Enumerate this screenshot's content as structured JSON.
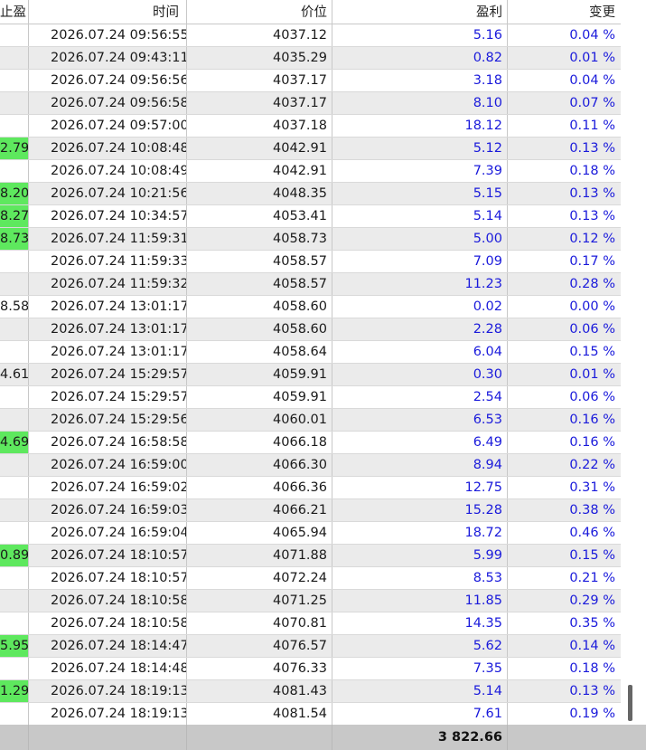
{
  "columns": [
    "止盈",
    "时间",
    "价位",
    "盈利",
    "变更"
  ],
  "rows": [
    {
      "tp": "",
      "time": "2026.07.24 09:56:55",
      "price": "4037.12",
      "profit": "5.16",
      "change": "0.04 %",
      "tp_highlight": false
    },
    {
      "tp": "",
      "time": "2026.07.24 09:43:11",
      "price": "4035.29",
      "profit": "0.82",
      "change": "0.01 %",
      "tp_highlight": false
    },
    {
      "tp": "",
      "time": "2026.07.24 09:56:56",
      "price": "4037.17",
      "profit": "3.18",
      "change": "0.04 %",
      "tp_highlight": false
    },
    {
      "tp": "",
      "time": "2026.07.24 09:56:58",
      "price": "4037.17",
      "profit": "8.10",
      "change": "0.07 %",
      "tp_highlight": false
    },
    {
      "tp": "",
      "time": "2026.07.24 09:57:00",
      "price": "4037.18",
      "profit": "18.12",
      "change": "0.11 %",
      "tp_highlight": false
    },
    {
      "tp": "2.79",
      "time": "2026.07.24 10:08:48",
      "price": "4042.91",
      "profit": "5.12",
      "change": "0.13 %",
      "tp_highlight": true
    },
    {
      "tp": "",
      "time": "2026.07.24 10:08:49",
      "price": "4042.91",
      "profit": "7.39",
      "change": "0.18 %",
      "tp_highlight": false
    },
    {
      "tp": "8.20",
      "time": "2026.07.24 10:21:56",
      "price": "4048.35",
      "profit": "5.15",
      "change": "0.13 %",
      "tp_highlight": true
    },
    {
      "tp": "8.27",
      "time": "2026.07.24 10:34:57",
      "price": "4053.41",
      "profit": "5.14",
      "change": "0.13 %",
      "tp_highlight": true
    },
    {
      "tp": "8.73",
      "time": "2026.07.24 11:59:31",
      "price": "4058.73",
      "profit": "5.00",
      "change": "0.12 %",
      "tp_highlight": true
    },
    {
      "tp": "",
      "time": "2026.07.24 11:59:33",
      "price": "4058.57",
      "profit": "7.09",
      "change": "0.17 %",
      "tp_highlight": false
    },
    {
      "tp": "",
      "time": "2026.07.24 11:59:32",
      "price": "4058.57",
      "profit": "11.23",
      "change": "0.28 %",
      "tp_highlight": false
    },
    {
      "tp": "8.58",
      "time": "2026.07.24 13:01:17",
      "price": "4058.60",
      "profit": "0.02",
      "change": "0.00 %",
      "tp_highlight": false
    },
    {
      "tp": "",
      "time": "2026.07.24 13:01:17",
      "price": "4058.60",
      "profit": "2.28",
      "change": "0.06 %",
      "tp_highlight": false
    },
    {
      "tp": "",
      "time": "2026.07.24 13:01:17",
      "price": "4058.64",
      "profit": "6.04",
      "change": "0.15 %",
      "tp_highlight": false
    },
    {
      "tp": "4.61",
      "time": "2026.07.24 15:29:57",
      "price": "4059.91",
      "profit": "0.30",
      "change": "0.01 %",
      "tp_highlight": false
    },
    {
      "tp": "",
      "time": "2026.07.24 15:29:57",
      "price": "4059.91",
      "profit": "2.54",
      "change": "0.06 %",
      "tp_highlight": false
    },
    {
      "tp": "",
      "time": "2026.07.24 15:29:56",
      "price": "4060.01",
      "profit": "6.53",
      "change": "0.16 %",
      "tp_highlight": false
    },
    {
      "tp": "4.69",
      "time": "2026.07.24 16:58:58",
      "price": "4066.18",
      "profit": "6.49",
      "change": "0.16 %",
      "tp_highlight": true
    },
    {
      "tp": "",
      "time": "2026.07.24 16:59:00",
      "price": "4066.30",
      "profit": "8.94",
      "change": "0.22 %",
      "tp_highlight": false
    },
    {
      "tp": "",
      "time": "2026.07.24 16:59:02",
      "price": "4066.36",
      "profit": "12.75",
      "change": "0.31 %",
      "tp_highlight": false
    },
    {
      "tp": "",
      "time": "2026.07.24 16:59:03",
      "price": "4066.21",
      "profit": "15.28",
      "change": "0.38 %",
      "tp_highlight": false
    },
    {
      "tp": "",
      "time": "2026.07.24 16:59:04",
      "price": "4065.94",
      "profit": "18.72",
      "change": "0.46 %",
      "tp_highlight": false
    },
    {
      "tp": "0.89",
      "time": "2026.07.24 18:10:57",
      "price": "4071.88",
      "profit": "5.99",
      "change": "0.15 %",
      "tp_highlight": true
    },
    {
      "tp": "",
      "time": "2026.07.24 18:10:57",
      "price": "4072.24",
      "profit": "8.53",
      "change": "0.21 %",
      "tp_highlight": false
    },
    {
      "tp": "",
      "time": "2026.07.24 18:10:58",
      "price": "4071.25",
      "profit": "11.85",
      "change": "0.29 %",
      "tp_highlight": false
    },
    {
      "tp": "",
      "time": "2026.07.24 18:10:58",
      "price": "4070.81",
      "profit": "14.35",
      "change": "0.35 %",
      "tp_highlight": false
    },
    {
      "tp": "5.95",
      "time": "2026.07.24 18:14:47",
      "price": "4076.57",
      "profit": "5.62",
      "change": "0.14 %",
      "tp_highlight": true
    },
    {
      "tp": "",
      "time": "2026.07.24 18:14:48",
      "price": "4076.33",
      "profit": "7.35",
      "change": "0.18 %",
      "tp_highlight": false
    },
    {
      "tp": "1.29",
      "time": "2026.07.24 18:19:13",
      "price": "4081.43",
      "profit": "5.14",
      "change": "0.13 %",
      "tp_highlight": true
    },
    {
      "tp": "",
      "time": "2026.07.24 18:19:13",
      "price": "4081.54",
      "profit": "7.61",
      "change": "0.19 %",
      "tp_highlight": false
    }
  ],
  "total": {
    "profit": "3 822.66"
  },
  "colors": {
    "positive_text": "#1a1adb",
    "tp_highlight": "#5ee85e",
    "alt_row": "#ebebeb",
    "total_bar": "#c8c8c8"
  }
}
